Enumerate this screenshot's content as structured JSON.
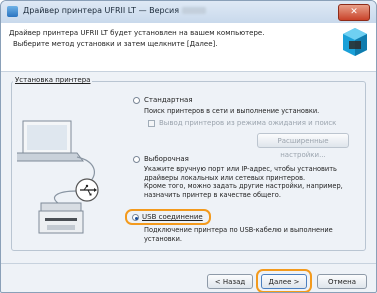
{
  "window": {
    "title": "Драйвер принтера UFRII LT — Версия",
    "close_label": "✕"
  },
  "header": {
    "line1": "Драйвер принтера UFRII LT будет установлен на вашем компьютере.",
    "line2": "Выберите метод установки и затем щелкните [Далее]."
  },
  "group": {
    "label": "Установка принтера"
  },
  "options": {
    "standard": {
      "label": "Стандартная",
      "desc": "Поиск принтеров в сети и выполнение установки.",
      "checkbox_label": "Вывод принтеров из режима ожидания и поиск",
      "button_label": "Расширенные настройки..."
    },
    "custom": {
      "label": "Выборочная",
      "desc_lines": [
        "Укажите вручную порт или IP-адрес, чтобы установить",
        "драйверы локальных или сетевых принтеров.",
        "Кроме того, можно задать другие настройки, например,",
        "назначить принтер в качестве общего."
      ]
    },
    "usb": {
      "label": "USB соединение",
      "desc_lines": [
        "Подключение принтера по USB-кабелю и выполнение",
        "установки."
      ],
      "selected": true
    }
  },
  "footer": {
    "back_label": "< Назад",
    "next_label": "Далее >",
    "cancel_label": "Отмена"
  },
  "colors": {
    "highlight": "#f39a1d",
    "selected_radio": "#1c4f9c"
  }
}
